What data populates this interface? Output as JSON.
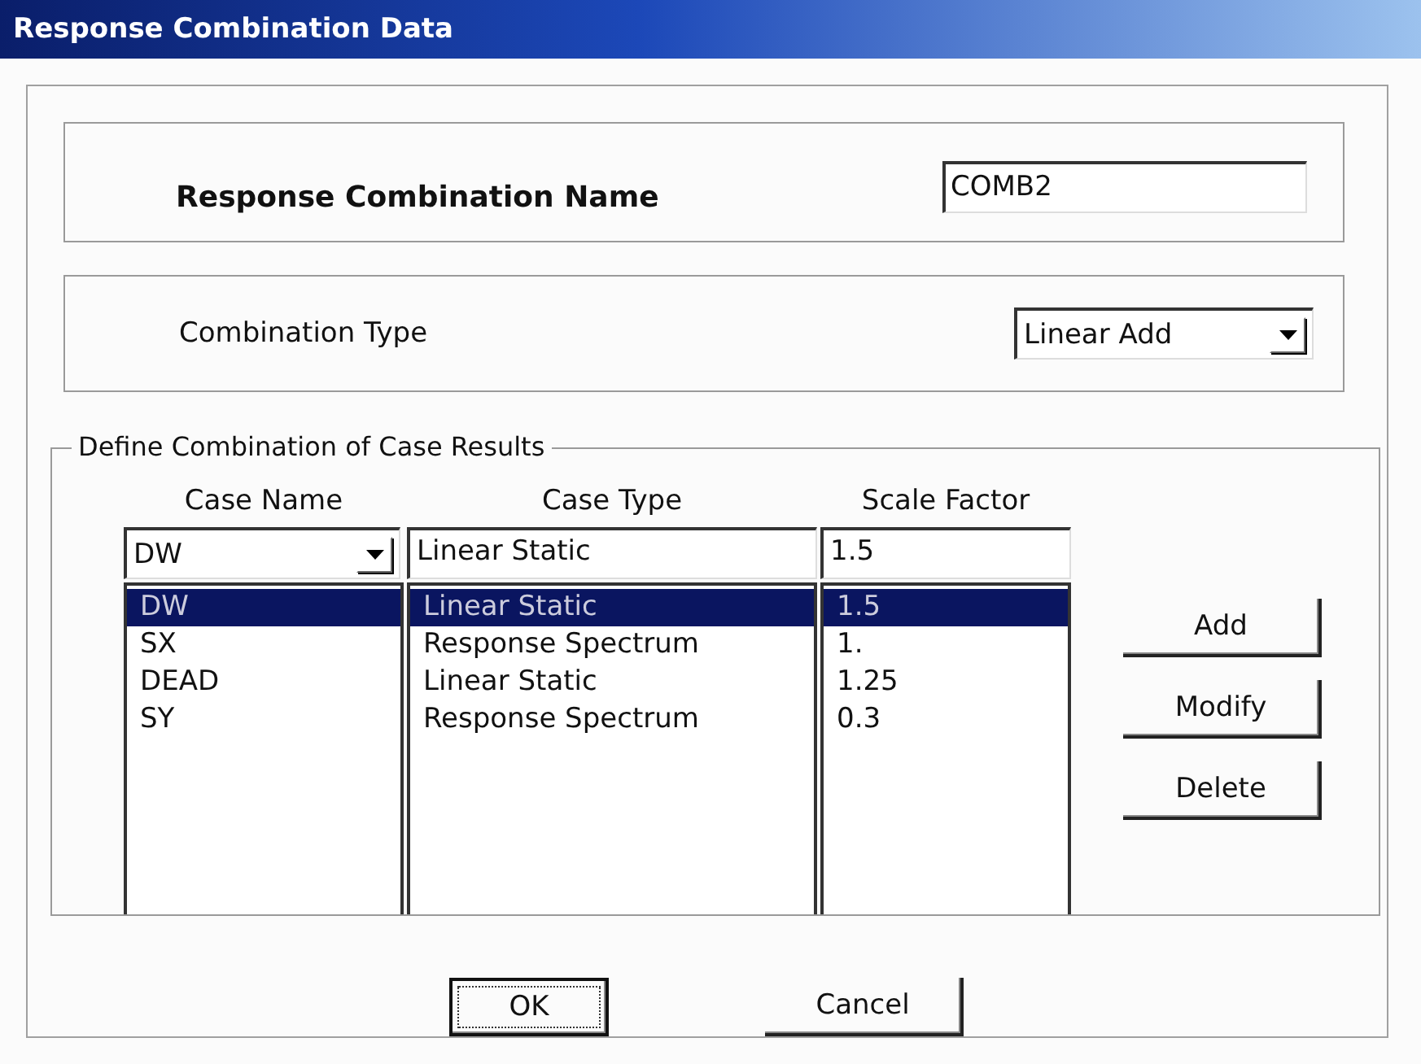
{
  "window": {
    "title": "Response Combination Data"
  },
  "name_field": {
    "label": "Response Combination Name",
    "value": "COMB2"
  },
  "combination_type": {
    "label": "Combination Type",
    "value": "Linear Add"
  },
  "case_results": {
    "title": "Define Combination of Case Results",
    "columns": [
      "Case Name",
      "Case Type",
      "Scale Factor"
    ],
    "inputs": {
      "case_name": "DW",
      "case_type": "Linear Static",
      "scale_factor": "1.5"
    },
    "rows": [
      {
        "case_name": "DW",
        "case_type": "Linear Static",
        "scale_factor": "1.5",
        "selected": true
      },
      {
        "case_name": "SX",
        "case_type": "Response Spectrum",
        "scale_factor": "1.",
        "selected": false
      },
      {
        "case_name": "DEAD",
        "case_type": "Linear Static",
        "scale_factor": "1.25",
        "selected": false
      },
      {
        "case_name": "SY",
        "case_type": "Response Spectrum",
        "scale_factor": "0.3",
        "selected": false
      }
    ],
    "buttons": [
      "Add",
      "Modify",
      "Delete"
    ]
  },
  "dialog_buttons": [
    {
      "label": "OK",
      "default": true
    },
    {
      "label": "Cancel",
      "default": false
    }
  ]
}
